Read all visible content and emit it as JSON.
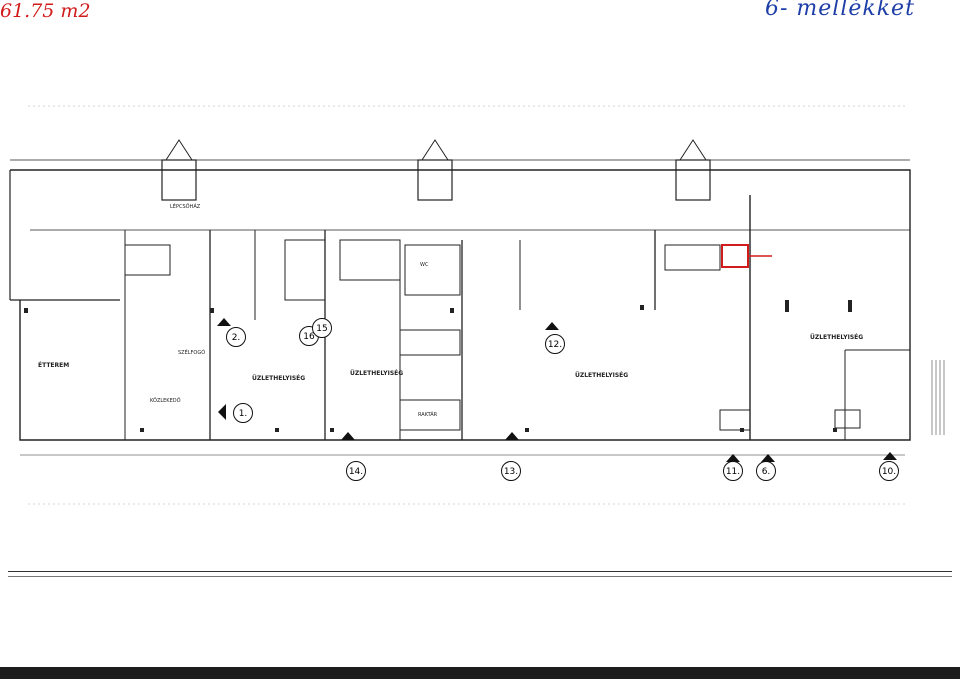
{
  "header": {
    "annex_label": "6- mellékket"
  },
  "annotation": {
    "area_text": "61.75 m2"
  },
  "markers": [
    {
      "id": "m1",
      "label": "1."
    },
    {
      "id": "m2",
      "label": "2."
    },
    {
      "id": "m16",
      "label": "16"
    },
    {
      "id": "m15",
      "label": "15"
    },
    {
      "id": "m12",
      "label": "12."
    },
    {
      "id": "m14",
      "label": "14."
    },
    {
      "id": "m13",
      "label": "13."
    },
    {
      "id": "m11",
      "label": "11."
    },
    {
      "id": "m6",
      "label": "6."
    },
    {
      "id": "m10",
      "label": "10."
    }
  ],
  "room_labels": [
    {
      "id": "r1",
      "text": "ÜZLETHELYISÉG"
    },
    {
      "id": "r2",
      "text": "ÜZLETHELYISÉG"
    },
    {
      "id": "r3",
      "text": "ÜZLETHELYISÉG"
    },
    {
      "id": "r4",
      "text": "ÜZLETHELYISÉG"
    },
    {
      "id": "r5",
      "text": "ÉTTEREM"
    },
    {
      "id": "r6",
      "text": "KÖZLEKEDŐ"
    },
    {
      "id": "r7",
      "text": "SZÉLFOGÓ"
    },
    {
      "id": "r8",
      "text": "LÉPCSŐHÁZ"
    },
    {
      "id": "r9",
      "text": "WC"
    },
    {
      "id": "r10",
      "text": "RAKTÁR"
    }
  ],
  "colors": {
    "ink": "#222222",
    "highlight": "#d21c1c",
    "handwriting": "#1f3fa8"
  }
}
